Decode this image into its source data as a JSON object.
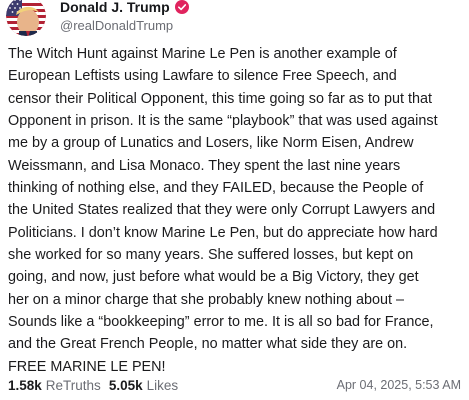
{
  "author": {
    "display_name": "Donald J. Trump",
    "handle": "@realDonaldTrump",
    "verified_icon": "verified-badge-icon",
    "badge_color": "#e0245e"
  },
  "post": {
    "lines": [
      "The Witch Hunt against Marine Le Pen is another example of",
      "European Leftists using Lawfare to silence Free Speech, and",
      "censor their Political Opponent, this time going so far as to put that",
      "Opponent in prison. It is the same “playbook” that was used against",
      "me by a group of Lunatics and Losers, like Norm Eisen, Andrew",
      "Weissmann, and Lisa Monaco. They spent the last nine years",
      "thinking of nothing else, and they FAILED, because the People of",
      "the United States realized that they were only Corrupt Lawyers and",
      "Politicians. I don’t know Marine Le Pen, but do appreciate how hard",
      "she worked for so many years. She suffered losses, but kept on",
      "going, and now, just before what would be a Big Victory, they get",
      "her on a minor charge that she probably knew nothing about –",
      "Sounds like a “bookkeeping” error to me. It is all so bad for France,",
      "and the Great French People, no matter what side they are on.",
      "FREE MARINE LE PEN!"
    ]
  },
  "stats": {
    "retruths_count": "1.58k",
    "retruths_label": "ReTruths",
    "likes_count": "5.05k",
    "likes_label": "Likes"
  },
  "timestamp": "Apr 04, 2025, 5:53 AM"
}
